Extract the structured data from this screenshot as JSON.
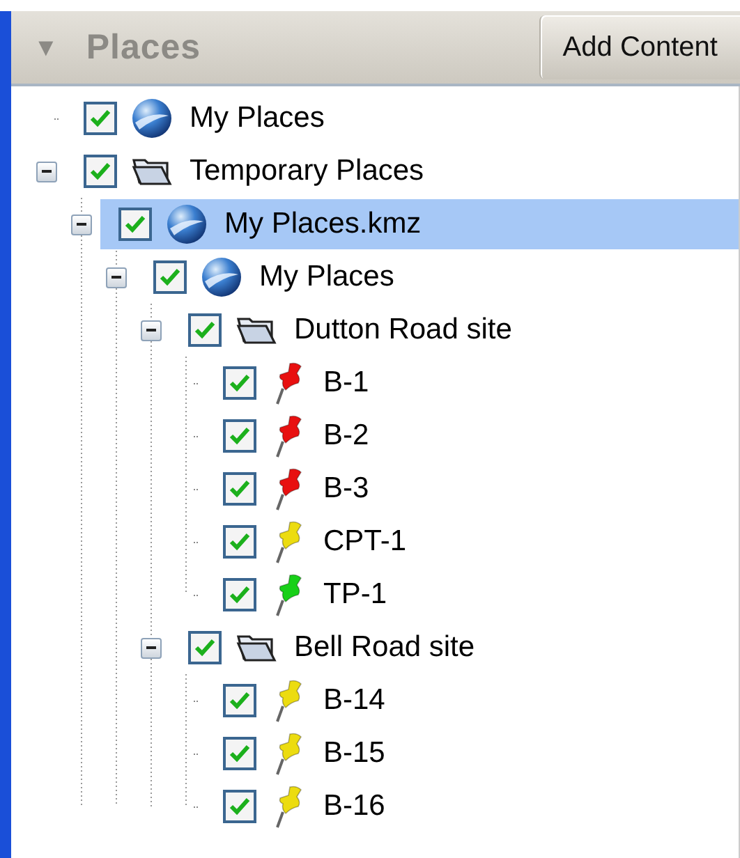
{
  "header": {
    "toggle": "▼",
    "title": "Places",
    "button": "Add Content"
  },
  "tree": [
    {
      "label": "My Places",
      "kind": "globe",
      "checked": true,
      "selected": false
    },
    {
      "label": "Temporary Places",
      "kind": "folder",
      "checked": true,
      "selected": false,
      "expanded": true,
      "children": [
        {
          "label": "My Places.kmz",
          "kind": "globe",
          "checked": true,
          "selected": true,
          "expanded": true,
          "children": [
            {
              "label": "My Places",
              "kind": "globe",
              "checked": true,
              "selected": false,
              "expanded": true,
              "children": [
                {
                  "label": "Dutton Road site",
                  "kind": "folder",
                  "checked": true,
                  "selected": false,
                  "expanded": true,
                  "children": [
                    {
                      "label": "B-1",
                      "kind": "pin",
                      "color": "#e81010",
                      "checked": true,
                      "selected": false
                    },
                    {
                      "label": "B-2",
                      "kind": "pin",
                      "color": "#e81010",
                      "checked": true,
                      "selected": false
                    },
                    {
                      "label": "B-3",
                      "kind": "pin",
                      "color": "#e81010",
                      "checked": true,
                      "selected": false
                    },
                    {
                      "label": "CPT-1",
                      "kind": "pin",
                      "color": "#ecdc10",
                      "checked": true,
                      "selected": false
                    },
                    {
                      "label": "TP-1",
                      "kind": "pin",
                      "color": "#18d018",
                      "checked": true,
                      "selected": false
                    }
                  ]
                },
                {
                  "label": "Bell Road site",
                  "kind": "folder",
                  "checked": true,
                  "selected": false,
                  "expanded": true,
                  "children": [
                    {
                      "label": "B-14",
                      "kind": "pin",
                      "color": "#ecdc10",
                      "checked": true,
                      "selected": false
                    },
                    {
                      "label": "B-15",
                      "kind": "pin",
                      "color": "#ecdc10",
                      "checked": true,
                      "selected": false
                    },
                    {
                      "label": "B-16",
                      "kind": "pin",
                      "color": "#ecdc10",
                      "checked": true,
                      "selected": false
                    }
                  ]
                }
              ]
            }
          ]
        }
      ]
    }
  ]
}
